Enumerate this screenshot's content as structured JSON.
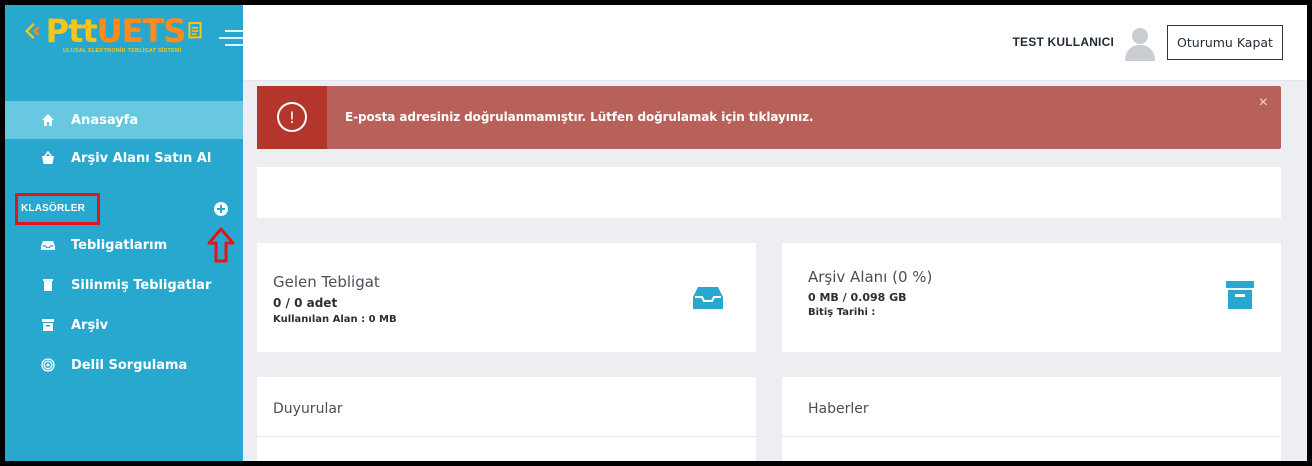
{
  "brand": {
    "logo_ptt": "Ptt",
    "logo_uets": "UETS",
    "logo_subtitle": "ULUSAL ELEKTRONİK TEBLİGAT SİSTEMİ",
    "logo_icon": "arrow-logo-icon"
  },
  "header": {
    "user_name": "TEST KULLANICI",
    "logout_label": "Oturumu Kapat",
    "avatar_icon": "user-avatar-icon",
    "menu_icon": "hamburger-icon"
  },
  "sidebar": {
    "items": [
      {
        "label": "Anasayfa",
        "icon": "home-icon",
        "active": true
      },
      {
        "label": "Arşiv Alanı Satın Al",
        "icon": "basket-icon",
        "active": false
      }
    ],
    "section_label": "KLASÖRLER",
    "add_icon": "plus-circle-icon",
    "folders": [
      {
        "label": "Tebligatlarım",
        "icon": "inbox-icon"
      },
      {
        "label": "Silinmiş Tebligatlar",
        "icon": "trash-icon"
      },
      {
        "label": "Arşiv",
        "icon": "archive-icon"
      },
      {
        "label": "Delil Sorgulama",
        "icon": "fingerprint-icon"
      }
    ]
  },
  "alert": {
    "text": "E-posta adresiniz doğrulanmamıştır. Lütfen doğrulamak için tıklayınız.",
    "icon": "exclamation-circle-icon",
    "close": "×",
    "color": "#b8605a"
  },
  "cards": {
    "incoming": {
      "title": "Gelen Tebligat",
      "count": "0 / 0 adet",
      "usage": "Kullanılan Alan : 0 MB",
      "icon": "inbox-icon"
    },
    "archive": {
      "title": "Arşiv Alanı (0 %)",
      "size": "0 MB / 0.098 GB",
      "end_date": "Bitiş Tarihi :",
      "icon": "archive-box-icon"
    }
  },
  "panels": {
    "announcements": "Duyurular",
    "news": "Haberler"
  },
  "colors": {
    "sidebar": "#29a8cf",
    "sidebar_active": "#69c8e1",
    "alert": "#b8605a",
    "alert_icon_bg": "#b4352c",
    "highlight": "#e3141c"
  }
}
